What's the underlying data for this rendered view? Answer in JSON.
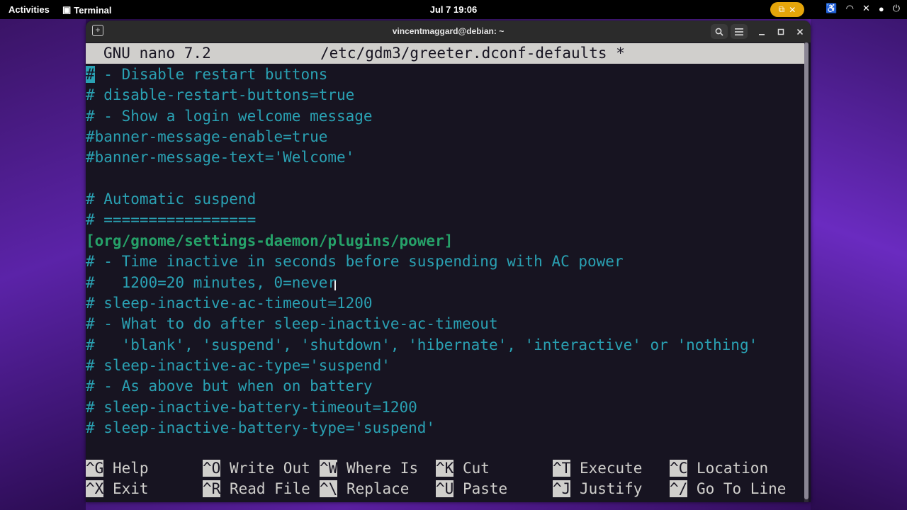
{
  "topbar": {
    "activities": "Activities",
    "app_name": "Terminal",
    "clock": "Jul 7  19:06"
  },
  "window": {
    "title": "vincentmaggard@debian: ~"
  },
  "nano": {
    "version": "GNU nano 7.2",
    "filename": "/etc/gdm3/greeter.dconf-defaults *",
    "lines": [
      {
        "cursor": "#",
        "text": " - Disable restart buttons"
      },
      {
        "text": "# disable-restart-buttons=true"
      },
      {
        "text": "# - Show a login welcome message"
      },
      {
        "text": "#banner-message-enable=true"
      },
      {
        "text": "#banner-message-text='Welcome'"
      },
      {
        "text": ""
      },
      {
        "text": "# Automatic suspend"
      },
      {
        "text": "# ================="
      },
      {
        "section": "[org/gnome/settings-daemon/plugins/power]"
      },
      {
        "text": "# - Time inactive in seconds before suspending with AC power"
      },
      {
        "text": "#   1200=20 minutes, 0=never"
      },
      {
        "text": "# sleep-inactive-ac-timeout=1200"
      },
      {
        "text": "# - What to do after sleep-inactive-ac-timeout"
      },
      {
        "text": "#   'blank', 'suspend', 'shutdown', 'hibernate', 'interactive' or 'nothing'"
      },
      {
        "text": "# sleep-inactive-ac-type='suspend'"
      },
      {
        "text": "# - As above but when on battery"
      },
      {
        "text": "# sleep-inactive-battery-timeout=1200"
      },
      {
        "text": "# sleep-inactive-battery-type='suspend'"
      }
    ],
    "shortcuts_row1": [
      {
        "key": "^G",
        "label": "Help"
      },
      {
        "key": "^O",
        "label": "Write Out"
      },
      {
        "key": "^W",
        "label": "Where Is"
      },
      {
        "key": "^K",
        "label": "Cut"
      },
      {
        "key": "^T",
        "label": "Execute"
      },
      {
        "key": "^C",
        "label": "Location"
      }
    ],
    "shortcuts_row2": [
      {
        "key": "^X",
        "label": "Exit"
      },
      {
        "key": "^R",
        "label": "Read File"
      },
      {
        "key": "^\\",
        "label": "Replace"
      },
      {
        "key": "^U",
        "label": "Paste"
      },
      {
        "key": "^J",
        "label": "Justify"
      },
      {
        "key": "^/",
        "label": "Go To Line"
      }
    ]
  },
  "colors": {
    "comment": "#2aa1b3",
    "section": "#26a269",
    "background": "#171421",
    "screencast_indicator": "#e5a50a"
  }
}
